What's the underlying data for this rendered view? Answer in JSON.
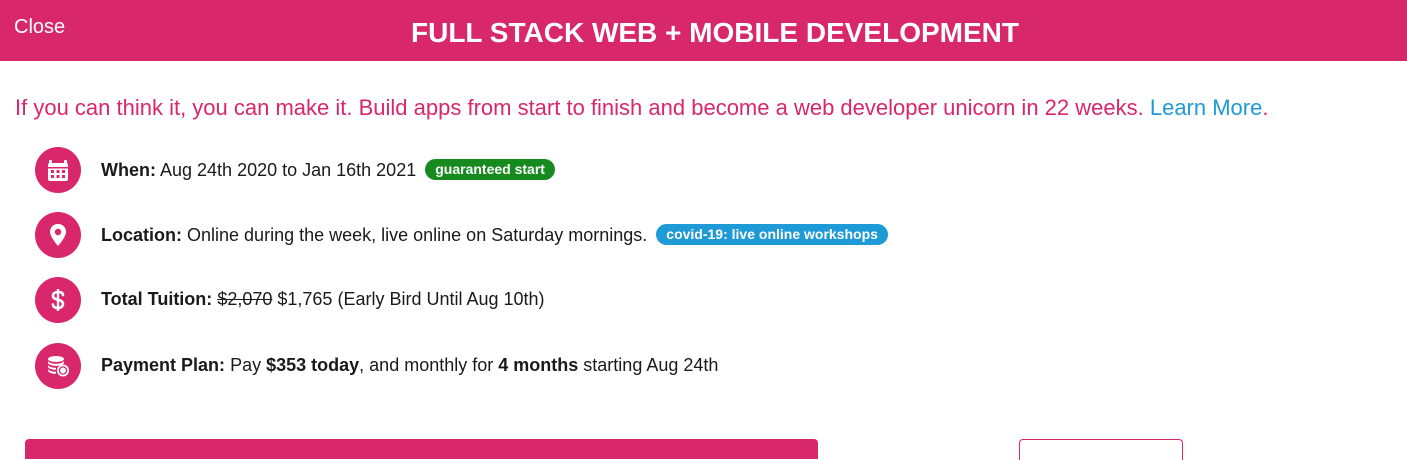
{
  "header": {
    "close_label": "Close",
    "title": "FULL STACK WEB + MOBILE DEVELOPMENT",
    "brand_color": "#d8276a"
  },
  "tagline": {
    "text": "If you can think it, you can make it. Build apps from start to finish and become a web developer unicorn in 22 weeks.",
    "link_label": "Learn More",
    "trailing": "."
  },
  "details": {
    "when": {
      "icon": "calendar-icon",
      "label": "When:",
      "value": "Aug 24th 2020 to Jan 16th 2021",
      "badge": "guaranteed start"
    },
    "location": {
      "icon": "map-pin-icon",
      "label": "Location:",
      "value": "Online during the week, live online on Saturday mornings.",
      "badge": "covid-19: live online workshops"
    },
    "tuition": {
      "icon": "dollar-icon",
      "label": "Total Tuition:",
      "old_price": "$2,070",
      "new_price": "$1,765 (Early Bird Until Aug 10th)"
    },
    "payment": {
      "icon": "coins-icon",
      "label": "Payment Plan:",
      "pre": "Pay",
      "amount_today": "$353 today",
      "mid": ", and monthly for",
      "months": "4 months",
      "post": "starting Aug 24th"
    }
  },
  "colors": {
    "accent": "#d8276a",
    "link": "#1e9ad6",
    "badge_green": "#168a1f",
    "badge_blue": "#1e9ad6"
  }
}
